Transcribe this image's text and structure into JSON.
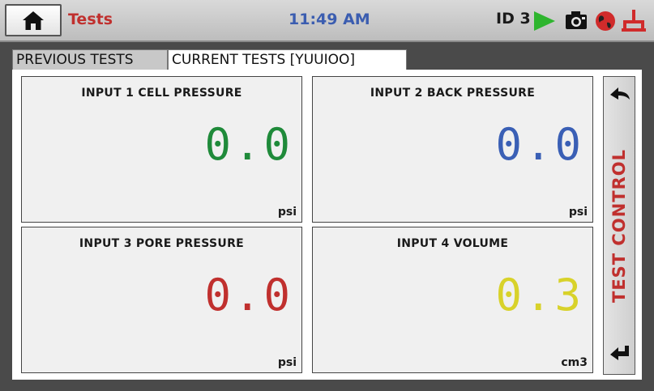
{
  "header": {
    "title": "Tests",
    "time": "11:49 AM",
    "id_label": "ID 3",
    "icons": [
      "home-icon",
      "play-icon",
      "camera-icon",
      "globe-icon",
      "network-icon"
    ]
  },
  "tabs": [
    {
      "label": "PREVIOUS TESTS",
      "active": false
    },
    {
      "label": "CURRENT TESTS [YUUIOO]",
      "active": true
    }
  ],
  "inputs": [
    {
      "title": "INPUT 1 CELL PRESSURE",
      "value": "0.0",
      "unit": "psi",
      "color": "#1f8a3a"
    },
    {
      "title": "INPUT 2 BACK PRESSURE",
      "value": "0.0",
      "unit": "psi",
      "color": "#3a5fb5"
    },
    {
      "title": "INPUT 3 PORE PRESSURE",
      "value": "0.0",
      "unit": "psi",
      "color": "#c0302e"
    },
    {
      "title": "INPUT 4 VOLUME",
      "value": "0.3",
      "unit": "cm3",
      "color": "#d8d22a"
    }
  ],
  "test_control": {
    "label": "TEST CONTROL",
    "icons": [
      "back-arrow-icon",
      "return-arrow-icon"
    ]
  },
  "colors": {
    "title_red": "#c0302e",
    "clock_blue": "#3b5db0",
    "play_green": "#2fb52f"
  }
}
